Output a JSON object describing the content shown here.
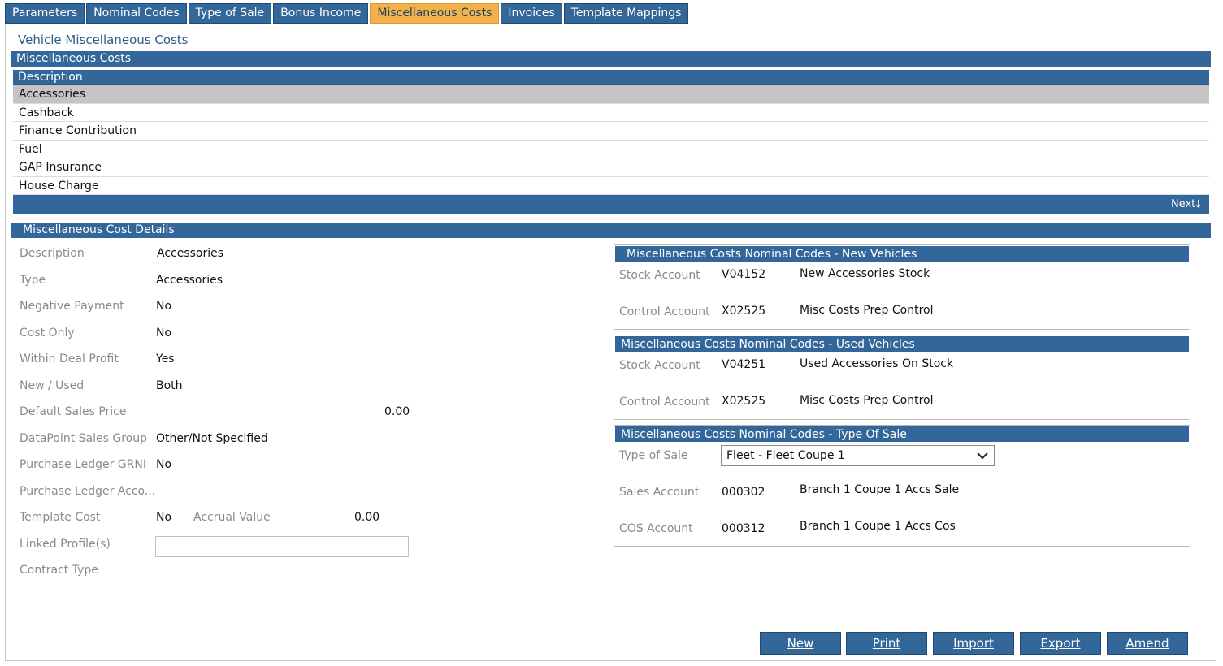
{
  "tabs": [
    {
      "label": "Parameters",
      "active": false
    },
    {
      "label": "Nominal Codes",
      "active": false
    },
    {
      "label": "Type of Sale",
      "active": false
    },
    {
      "label": "Bonus Income",
      "active": false
    },
    {
      "label": "Miscellaneous Costs",
      "active": true
    },
    {
      "label": "Invoices",
      "active": false
    },
    {
      "label": "Template Mappings",
      "active": false
    }
  ],
  "page_title": "Vehicle Miscellaneous Costs",
  "misc_costs_section": {
    "title": "Miscellaneous Costs",
    "column_header": "Description",
    "rows": [
      "Accessories",
      "Cashback",
      "Finance Contribution",
      "Fuel",
      "GAP Insurance",
      "House Charge"
    ],
    "selected_row": "Accessories",
    "next_label": "Next🡓"
  },
  "details": {
    "title": "Miscellaneous Cost Details",
    "fields": {
      "description": {
        "label": "Description",
        "value": "Accessories"
      },
      "type": {
        "label": "Type",
        "value": "Accessories"
      },
      "negative_payment": {
        "label": "Negative Payment",
        "value": "No"
      },
      "cost_only": {
        "label": "Cost Only",
        "value": "No"
      },
      "within_deal_profit": {
        "label": "Within Deal Profit",
        "value": "Yes"
      },
      "new_used": {
        "label": "New / Used",
        "value": "Both"
      },
      "default_sales_price": {
        "label": "Default Sales Price",
        "value": "0.00"
      },
      "datapoint_sales_group": {
        "label": "DataPoint Sales Group",
        "value": "Other/Not Specified"
      },
      "purchase_ledger_grni": {
        "label": "Purchase Ledger GRNI",
        "value": "No"
      },
      "purchase_ledger_account": {
        "label": "Purchase Ledger Acco...",
        "value": ""
      },
      "template_cost": {
        "label": "Template Cost",
        "value": "No"
      },
      "accrual_value": {
        "label": "Accrual Value",
        "value": "0.00"
      },
      "linked_profiles": {
        "label": "Linked Profile(s)",
        "value": ""
      },
      "contract_type": {
        "label": "Contract Type",
        "value": ""
      }
    }
  },
  "panels": {
    "new_vehicles": {
      "title": "Miscellaneous Costs Nominal Codes - New Vehicles",
      "stock": {
        "label": "Stock Account",
        "code": "V04152",
        "desc": "New Accessories Stock"
      },
      "control": {
        "label": "Control Account",
        "code": "X02525",
        "desc": "Misc Costs Prep Control"
      }
    },
    "used_vehicles": {
      "title": "Miscellaneous Costs Nominal Codes - Used Vehicles",
      "stock": {
        "label": "Stock Account",
        "code": "V04251",
        "desc": "Used Accessories On Stock"
      },
      "control": {
        "label": "Control Account",
        "code": "X02525",
        "desc": "Misc Costs Prep Control"
      }
    },
    "type_of_sale": {
      "title": "Miscellaneous Costs Nominal Codes - Type Of Sale",
      "type_of_sale": {
        "label": "Type of Sale",
        "selected": "Fleet - Fleet Coupe 1"
      },
      "sales": {
        "label": "Sales Account",
        "code": "000302",
        "desc": "Branch 1 Coupe 1 Accs Sale"
      },
      "cos": {
        "label": "COS Account",
        "code": "000312",
        "desc": "Branch 1 Coupe 1 Accs Cos"
      }
    }
  },
  "buttons": {
    "new": "New",
    "print": "Print",
    "import": "Import",
    "export": "Export",
    "amend": "Amend"
  },
  "colors": {
    "primary": "#336699",
    "active_tab": "#f2b24a",
    "selected_row": "#c4c4c4"
  }
}
